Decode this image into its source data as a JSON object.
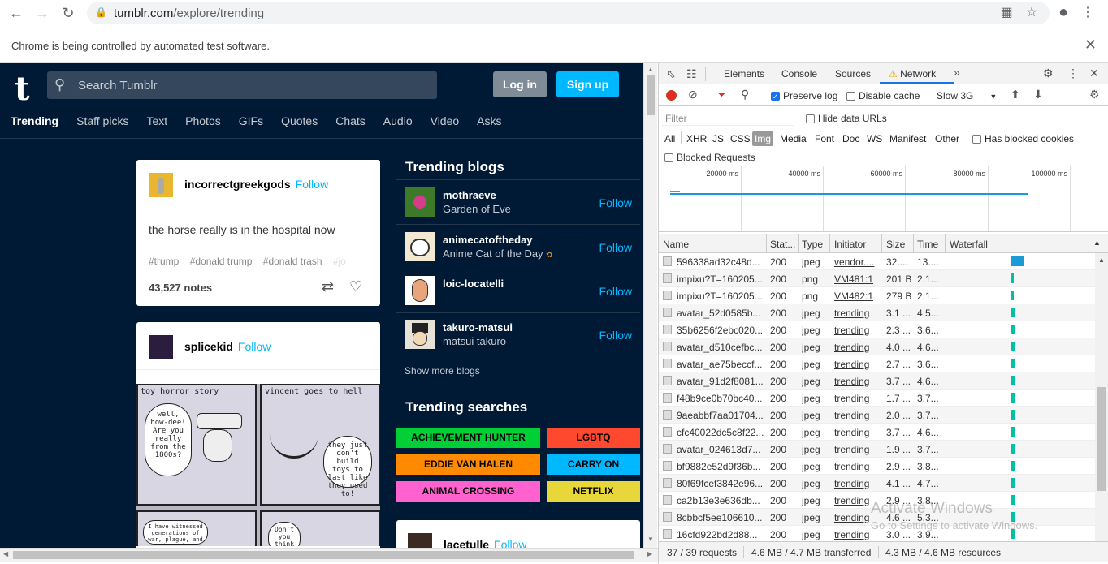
{
  "browser": {
    "url_host": "tumblr.com",
    "url_path": "/explore/trending",
    "infobar_text": "Chrome is being controlled by automated test software."
  },
  "tumblr": {
    "search_placeholder": "Search Tumblr",
    "login_label": "Log in",
    "signup_label": "Sign up",
    "tabs": [
      "Trending",
      "Staff picks",
      "Text",
      "Photos",
      "GIFs",
      "Quotes",
      "Chats",
      "Audio",
      "Video",
      "Asks"
    ],
    "post1": {
      "username": "incorrectgreekgods",
      "follow": "Follow",
      "body": "the horse really is in the hospital now",
      "tags": [
        "#trump",
        "#donald trump",
        "#donald trash",
        "#jo"
      ],
      "notes": "43,527 notes"
    },
    "post2": {
      "username": "splicekid",
      "follow": "Follow",
      "comic_panel1_caption": "toy horror story",
      "comic_panel2_caption": "vincent goes to hell",
      "bubble1": "well, how-dee! Are you really from the 1800s?",
      "bubble2": "they just don't build toys to last like they used to!",
      "bubble3": "I have witnessed generations of war, plague, and hatred.",
      "bubble4": "Don't you think"
    },
    "trending_blogs_title": "Trending blogs",
    "blogs": [
      {
        "name": "mothraeve",
        "title": "Garden of Eve",
        "follow": "Follow"
      },
      {
        "name": "animecatoftheday",
        "title": "Anime Cat of the Day",
        "follow": "Follow"
      },
      {
        "name": "loic-locatelli",
        "title": "",
        "follow": "Follow"
      },
      {
        "name": "takuro-matsui",
        "title": "matsui takuro",
        "follow": "Follow"
      }
    ],
    "show_more": "Show more blogs",
    "trending_searches_title": "Trending searches",
    "searches": [
      {
        "label": "ACHIEVEMENT HUNTER",
        "color": "#00cf35"
      },
      {
        "label": "LGBTQ",
        "color": "#ff492f"
      },
      {
        "label": "EDDIE VAN HALEN",
        "color": "#ff8a00"
      },
      {
        "label": "CARRY ON",
        "color": "#00b8ff"
      },
      {
        "label": "ANIMAL CROSSING",
        "color": "#ff62ce"
      },
      {
        "label": "NETFLIX",
        "color": "#e8d73a"
      }
    ],
    "post3": {
      "username": "lacetulle",
      "follow": "Follow"
    }
  },
  "devtools": {
    "tabs": [
      "Elements",
      "Console",
      "Sources",
      "Network"
    ],
    "toolbar": {
      "preserve_log": "Preserve log",
      "disable_cache": "Disable cache",
      "throttle": "Slow 3G"
    },
    "filter_placeholder": "Filter",
    "hide_data_urls": "Hide data URLs",
    "types": [
      "All",
      "XHR",
      "JS",
      "CSS",
      "Img",
      "Media",
      "Font",
      "Doc",
      "WS",
      "Manifest",
      "Other"
    ],
    "has_blocked_cookies": "Has blocked cookies",
    "blocked_requests": "Blocked Requests",
    "timeline_ticks": [
      "20000 ms",
      "40000 ms",
      "60000 ms",
      "80000 ms",
      "100000 ms"
    ],
    "columns": [
      "Name",
      "Stat...",
      "Type",
      "Initiator",
      "Size",
      "Time",
      "Waterfall"
    ],
    "rows": [
      {
        "name": "596338ad32c48d...",
        "status": "200",
        "type": "jpeg",
        "initiator": "vendor....",
        "size": "32....",
        "time": "13...."
      },
      {
        "name": "impixu?T=160205...",
        "status": "200",
        "type": "png",
        "initiator": "VM481:1",
        "size": "201 B",
        "time": "2.1..."
      },
      {
        "name": "impixu?T=160205...",
        "status": "200",
        "type": "png",
        "initiator": "VM482:1",
        "size": "279 B",
        "time": "2.1..."
      },
      {
        "name": "avatar_52d0585b...",
        "status": "200",
        "type": "jpeg",
        "initiator": "trending",
        "size": "3.1 ...",
        "time": "4.5..."
      },
      {
        "name": "35b6256f2ebc020...",
        "status": "200",
        "type": "jpeg",
        "initiator": "trending",
        "size": "2.3 ...",
        "time": "3.6..."
      },
      {
        "name": "avatar_d510cefbc...",
        "status": "200",
        "type": "jpeg",
        "initiator": "trending",
        "size": "4.0 ...",
        "time": "4.6..."
      },
      {
        "name": "avatar_ae75beccf...",
        "status": "200",
        "type": "jpeg",
        "initiator": "trending",
        "size": "2.7 ...",
        "time": "3.6..."
      },
      {
        "name": "avatar_91d2f8081...",
        "status": "200",
        "type": "jpeg",
        "initiator": "trending",
        "size": "3.7 ...",
        "time": "4.6..."
      },
      {
        "name": "f48b9ce0b70bc40...",
        "status": "200",
        "type": "jpeg",
        "initiator": "trending",
        "size": "1.7 ...",
        "time": "3.7..."
      },
      {
        "name": "9aeabbf7aa01704...",
        "status": "200",
        "type": "jpeg",
        "initiator": "trending",
        "size": "2.0 ...",
        "time": "3.7..."
      },
      {
        "name": "cfc40022dc5c8f22...",
        "status": "200",
        "type": "jpeg",
        "initiator": "trending",
        "size": "3.7 ...",
        "time": "4.6..."
      },
      {
        "name": "avatar_024613d7...",
        "status": "200",
        "type": "jpeg",
        "initiator": "trending",
        "size": "1.9 ...",
        "time": "3.7..."
      },
      {
        "name": "bf9882e52d9f36b...",
        "status": "200",
        "type": "jpeg",
        "initiator": "trending",
        "size": "2.9 ...",
        "time": "3.8..."
      },
      {
        "name": "80f69fcef3842e96...",
        "status": "200",
        "type": "jpeg",
        "initiator": "trending",
        "size": "4.1 ...",
        "time": "4.7..."
      },
      {
        "name": "ca2b13e3e636db...",
        "status": "200",
        "type": "jpeg",
        "initiator": "trending",
        "size": "2.9 ...",
        "time": "3.8..."
      },
      {
        "name": "8cbbcf5ee106610...",
        "status": "200",
        "type": "jpeg",
        "initiator": "trending",
        "size": "4.6 ...",
        "time": "5.3..."
      },
      {
        "name": "16cfd922bd2d88...",
        "status": "200",
        "type": "jpeg",
        "initiator": "trending",
        "size": "3.0 ...",
        "time": "3.9..."
      }
    ],
    "status_requests": "37 / 39 requests",
    "status_transferred": "4.6 MB / 4.7 MB transferred",
    "status_resources": "4.3 MB / 4.6 MB resources",
    "watermark_title": "Activate Windows",
    "watermark_sub": "Go to Settings to activate Windows."
  }
}
